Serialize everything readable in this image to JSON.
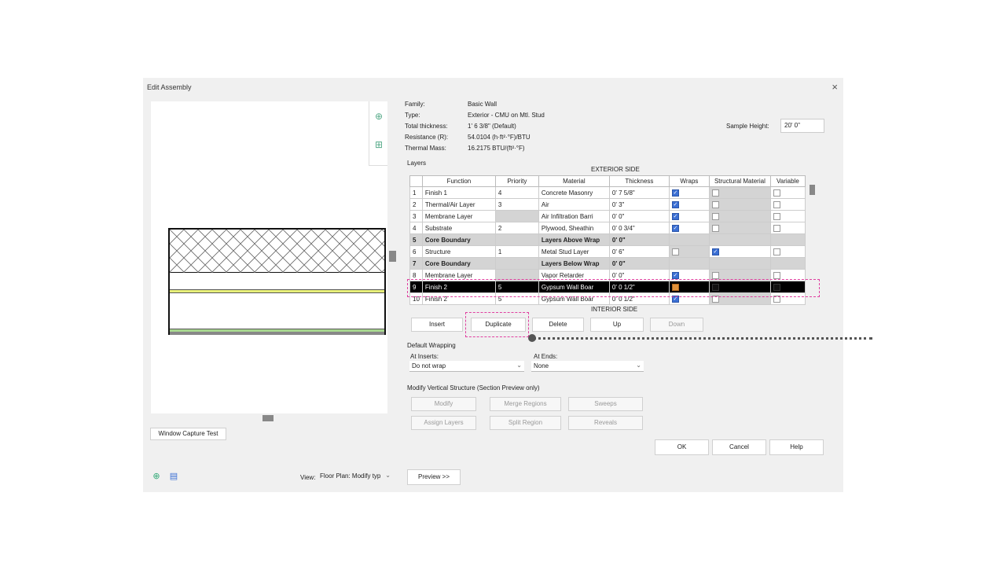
{
  "dialog": {
    "title": "Edit Assembly",
    "close": "×"
  },
  "props": [
    {
      "label": "Family:",
      "value": "Basic Wall"
    },
    {
      "label": "Type:",
      "value": "Exterior - CMU on Mtl. Stud"
    },
    {
      "label": "Total thickness:",
      "value": "1'  6 3/8\" (Default)"
    },
    {
      "label": "Resistance (R):",
      "value": "54.0104 (h·ft²·°F)/BTU"
    },
    {
      "label": "Thermal Mass:",
      "value": "16.2175 BTU/(ft²·°F)"
    }
  ],
  "sample": {
    "label": "Sample Height:",
    "value": "20'  0\""
  },
  "layers": {
    "label": "Layers",
    "exterior": "EXTERIOR SIDE",
    "interior": "INTERIOR SIDE",
    "headers": [
      "",
      "Function",
      "Priority",
      "Material",
      "Thickness",
      "Wraps",
      "Structural Material",
      "Variable"
    ],
    "rows": [
      {
        "n": "1",
        "fn": "Finish 1",
        "pr": "4",
        "mat": "Concrete Masonry",
        "th": "0'  7 5/8\"",
        "wrap": true,
        "struct": false,
        "var": false
      },
      {
        "n": "2",
        "fn": "Thermal/Air Layer",
        "pr": "3",
        "mat": "Air",
        "th": "0'  3\"",
        "wrap": true,
        "struct": false,
        "var": false
      },
      {
        "n": "3",
        "fn": "Membrane Layer",
        "pr": "",
        "mat": "Air Infiltration Barri",
        "th": "0'  0\"",
        "wrap": true,
        "struct": false,
        "var": false
      },
      {
        "n": "4",
        "fn": "Substrate",
        "pr": "2",
        "mat": "Plywood, Sheathin",
        "th": "0'  0 3/4\"",
        "wrap": true,
        "struct": false,
        "var": false
      },
      {
        "n": "5",
        "fn": "Core Boundary",
        "pr": "",
        "mat": "Layers Above Wrap",
        "th": "0'  0\"",
        "bold": true
      },
      {
        "n": "6",
        "fn": "Structure",
        "pr": "1",
        "mat": "Metal Stud Layer",
        "th": "0'  6\"",
        "wrap": false,
        "struct": true,
        "var": false
      },
      {
        "n": "7",
        "fn": "Core Boundary",
        "pr": "",
        "mat": "Layers Below Wrap",
        "th": "0'  0\"",
        "bold": true
      },
      {
        "n": "8",
        "fn": "Membrane Layer",
        "pr": "",
        "mat": "Vapor Retarder",
        "th": "0'  0\"",
        "wrap": true,
        "struct": false,
        "var": false
      },
      {
        "n": "9",
        "fn": "Finish 2",
        "pr": "5",
        "mat": "Gypsum Wall Boar",
        "th": "0'  0 1/2\"",
        "wrap": true,
        "struct": false,
        "var": false,
        "sel": true
      },
      {
        "n": "10",
        "fn": "Finish 2",
        "pr": "5",
        "mat": "Gypsum Wall Boar",
        "th": "0'  0 1/2\"",
        "wrap": true,
        "struct": false,
        "var": false
      }
    ]
  },
  "buttons": {
    "insert": "Insert",
    "duplicate": "Duplicate",
    "delete": "Delete",
    "up": "Up",
    "down": "Down"
  },
  "wrapping": {
    "label": "Default Wrapping",
    "inserts_label": "At Inserts:",
    "inserts_value": "Do not wrap",
    "ends_label": "At Ends:",
    "ends_value": "None"
  },
  "vertical": {
    "label": "Modify Vertical Structure (Section Preview only)",
    "modify": "Modify",
    "merge": "Merge Regions",
    "sweeps": "Sweeps",
    "assign": "Assign Layers",
    "split": "Split Region",
    "reveals": "Reveals"
  },
  "footer": {
    "ok": "OK",
    "cancel": "Cancel",
    "help": "Help",
    "capture": "Window Capture Test",
    "view_label": "View:",
    "view_value": "Floor Plan: Modify typ",
    "preview": "Preview >>"
  }
}
